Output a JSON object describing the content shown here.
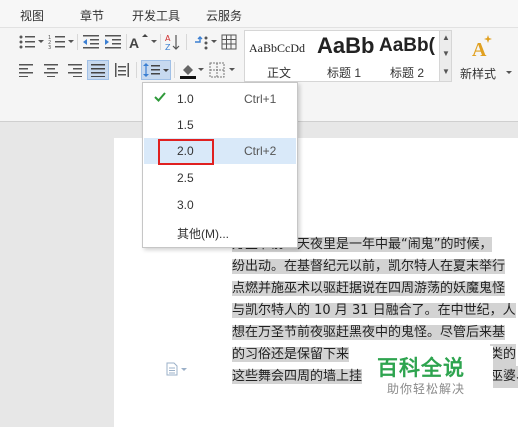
{
  "menubar": {
    "items": [
      "视图",
      "章节",
      "开发工具",
      "云服务"
    ]
  },
  "styles": {
    "tiles": [
      {
        "sample": "AaBbCcDd",
        "name": "正文"
      },
      {
        "sample": "AaBb",
        "name": "标题 1"
      },
      {
        "sample": "AaBb(",
        "name": "标题 2"
      }
    ],
    "new_style_label": "新样式"
  },
  "line_spacing_menu": {
    "items": [
      {
        "value": "1.0",
        "shortcut": "Ctrl+1",
        "checked": true
      },
      {
        "value": "1.5",
        "shortcut": ""
      },
      {
        "value": "2.0",
        "shortcut": "Ctrl+2",
        "highlighted": true
      },
      {
        "value": "2.5",
        "shortcut": ""
      },
      {
        "value": "3.0",
        "shortcut": ""
      },
      {
        "value": "其他(M)...",
        "shortcut": ""
      }
    ]
  },
  "document": {
    "lines": [
      "万圣节前一天夜里是一年中最“闹鬼”的时候，",
      "纷出动。在基督纪元以前，凯尔特人在夏末举行",
      "点燃并施巫术以驱赶据说在四周游荡的妖魔鬼怪",
      "与凯尔特人的 10 月 31 日融合了。在中世纪，人",
      "想在万圣节前夜驱赶黑夜中的鬼怪。尽管后来基",
      "的习俗还是保留下来",
      "这些舞会四周的墙上挂"
    ],
    "line6_tail": "类的",
    "line7_tail": "巫婆、"
  },
  "watermark": {
    "title": "百科全说",
    "subtitle": "助你轻松解决"
  },
  "colors": {
    "accent_check": "#2f9a3a",
    "highlight_box": "#e02020",
    "logo_green": "#2ea44f"
  }
}
